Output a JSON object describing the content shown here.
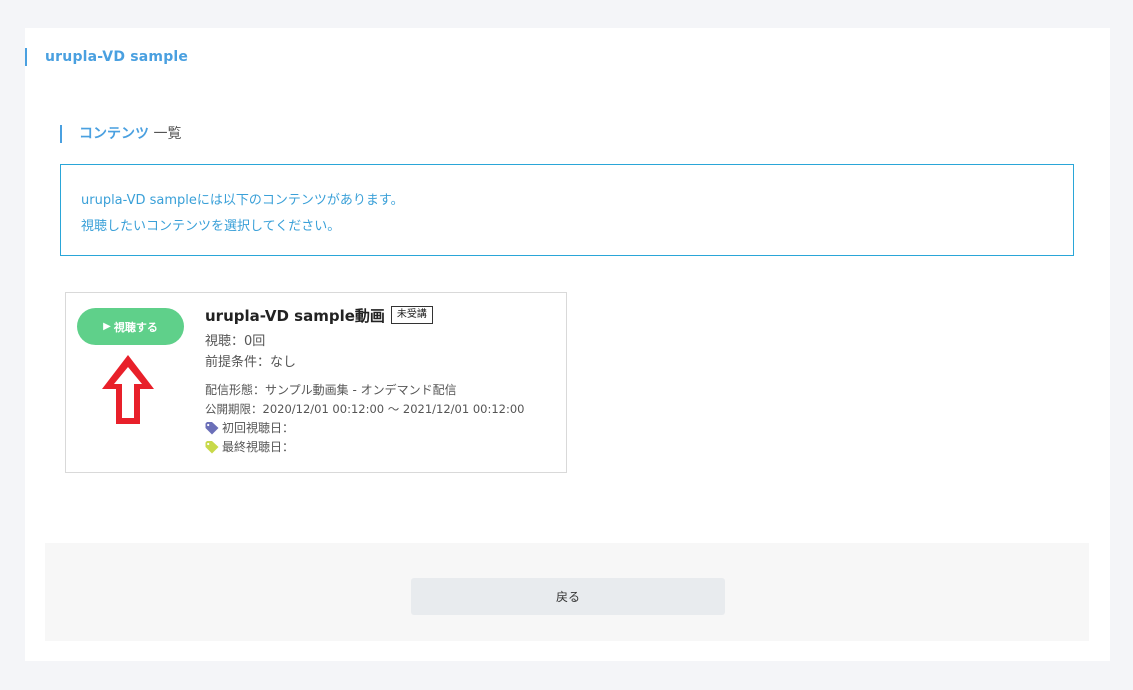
{
  "header": {
    "title": "urupla-VD sample"
  },
  "section": {
    "heading_accent": "コンテンツ",
    "heading_rest": " 一覧"
  },
  "info": {
    "line1": "urupla-VD sampleには以下のコンテンツがあります。",
    "line2": "視聴したいコンテンツを選択してください。"
  },
  "card": {
    "watch_label": "視聴する",
    "title": "urupla-VD sample動画",
    "badge": "未受講",
    "views": "視聴：0回",
    "prerequisite": "前提条件：なし",
    "delivery": "配信形態：サンプル動画集 - オンデマンド配信",
    "period": "公開期限：2020/12/01 00:12:00 ～ 2021/12/01 00:12:00",
    "first_view": "初回視聴日：",
    "last_view": "最終視聴日："
  },
  "footer": {
    "back_label": "戻る"
  },
  "colors": {
    "accent": "#4aa0e0",
    "watch_button": "#5fd08a",
    "arrow": "#e8202a",
    "first_tag": "#6b6fb8",
    "last_tag": "#c8d94a"
  },
  "icons": {
    "watch": "play-triangle-icon",
    "first_tag": "tag-icon",
    "last_tag": "tag-icon",
    "annotation": "up-arrow-icon"
  }
}
